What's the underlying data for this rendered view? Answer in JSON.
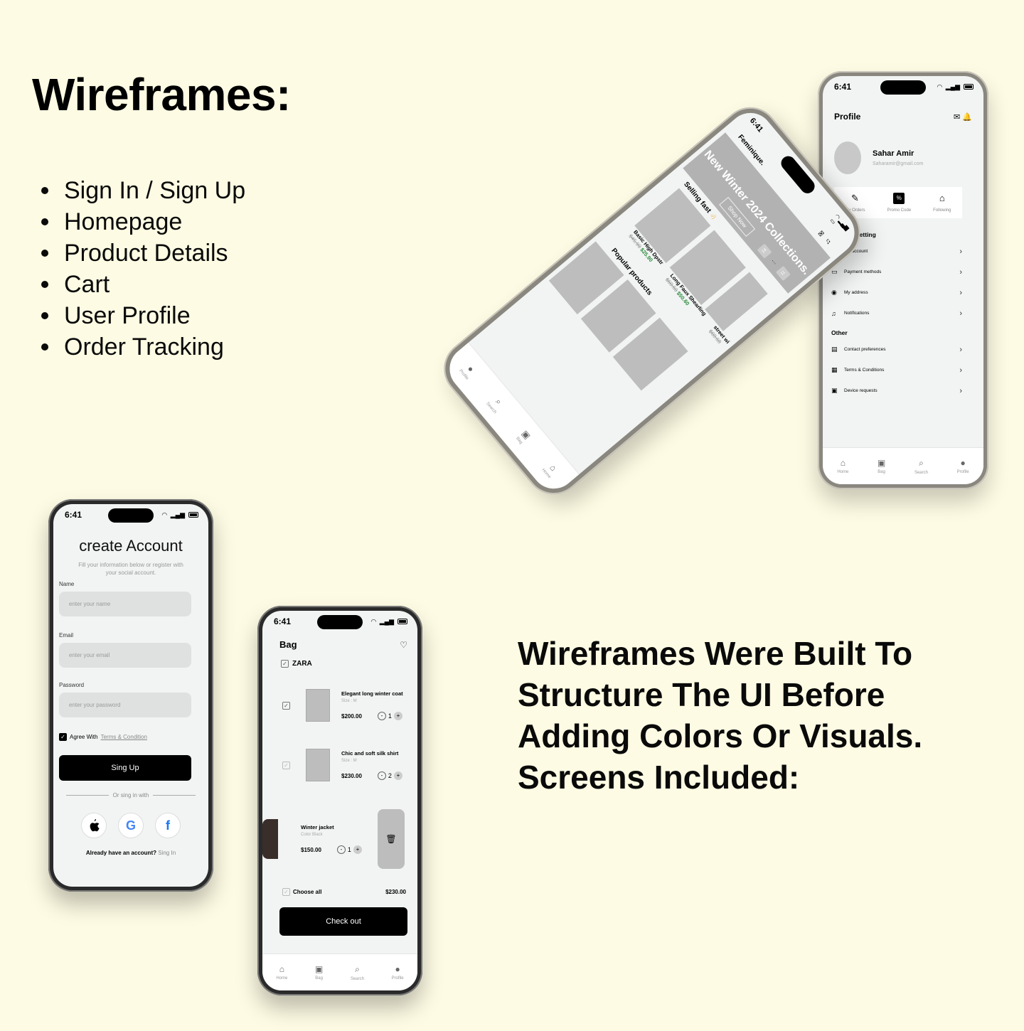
{
  "heading": "Wireframes:",
  "screens": [
    "Sign In / Sign Up",
    "Homepage",
    "Product Details",
    "Cart",
    "User Profile",
    "Order Tracking"
  ],
  "description": "Wireframes Were Built To Structure The UI Before Adding Colors Or Visuals. Screens Included:",
  "status_time": "6:41",
  "tabs": [
    "Home",
    "Bag",
    "Search",
    "Profile"
  ],
  "signup": {
    "title": "create Account",
    "subtitle": "Fill your information below or register with your social account.",
    "name_label": "Name",
    "name_placeholder": "enter your name",
    "email_label": "Email",
    "email_placeholder": "enter your email",
    "password_label": "Password",
    "password_placeholder": "enter your password",
    "agree_text": "Agree With",
    "terms_link": "Terms & Condition",
    "signup_button": "Sing Up",
    "or_text": "Or sing in with",
    "have_account": "Already have an account?",
    "sign_in_link": "Sing In"
  },
  "bag": {
    "title": "Bag",
    "store": "ZARA",
    "items": [
      {
        "name": "Elegant long winter coat",
        "meta": "Size : M",
        "price": "$200.00",
        "qty": "1"
      },
      {
        "name": "Chic and soft silk shirt",
        "meta": "Size : M",
        "price": "$230.00",
        "qty": "2"
      },
      {
        "name": "Winter jacket",
        "meta": "Color Black",
        "price": "$150.00",
        "qty": "1"
      }
    ],
    "choose_all": "Choose all",
    "total": "$230.00",
    "checkout": "Check out"
  },
  "profile": {
    "title": "Profile",
    "name": "Sahar Amir",
    "email": "Saharamir@gmail.com",
    "actions": [
      "My Orders",
      "Promo Code",
      "Following"
    ],
    "general_title": "General Setting",
    "general_items": [
      "My account",
      "Payment methods",
      "My address",
      "Notifications"
    ],
    "other_title": "Other",
    "other_items": [
      "Contact preferences",
      "Terms & Conditions",
      "Device requests"
    ]
  },
  "home": {
    "brand": "Feminique.",
    "banner_title": "New Winter 2024 Collections.",
    "banner_button": "Shop Now",
    "pages": [
      "14",
      "11"
    ],
    "selling_fast": "Selling fast",
    "products": [
      {
        "name": "Basic High Dpstr",
        "old": "$45.90",
        "new": "$25.90"
      },
      {
        "name": "Long Faux Shearling",
        "old": "$60.60",
        "new": "$50.60"
      },
      {
        "name": "street wi",
        "old": "$60.60",
        "new": ""
      }
    ],
    "popular": "Popular products"
  }
}
